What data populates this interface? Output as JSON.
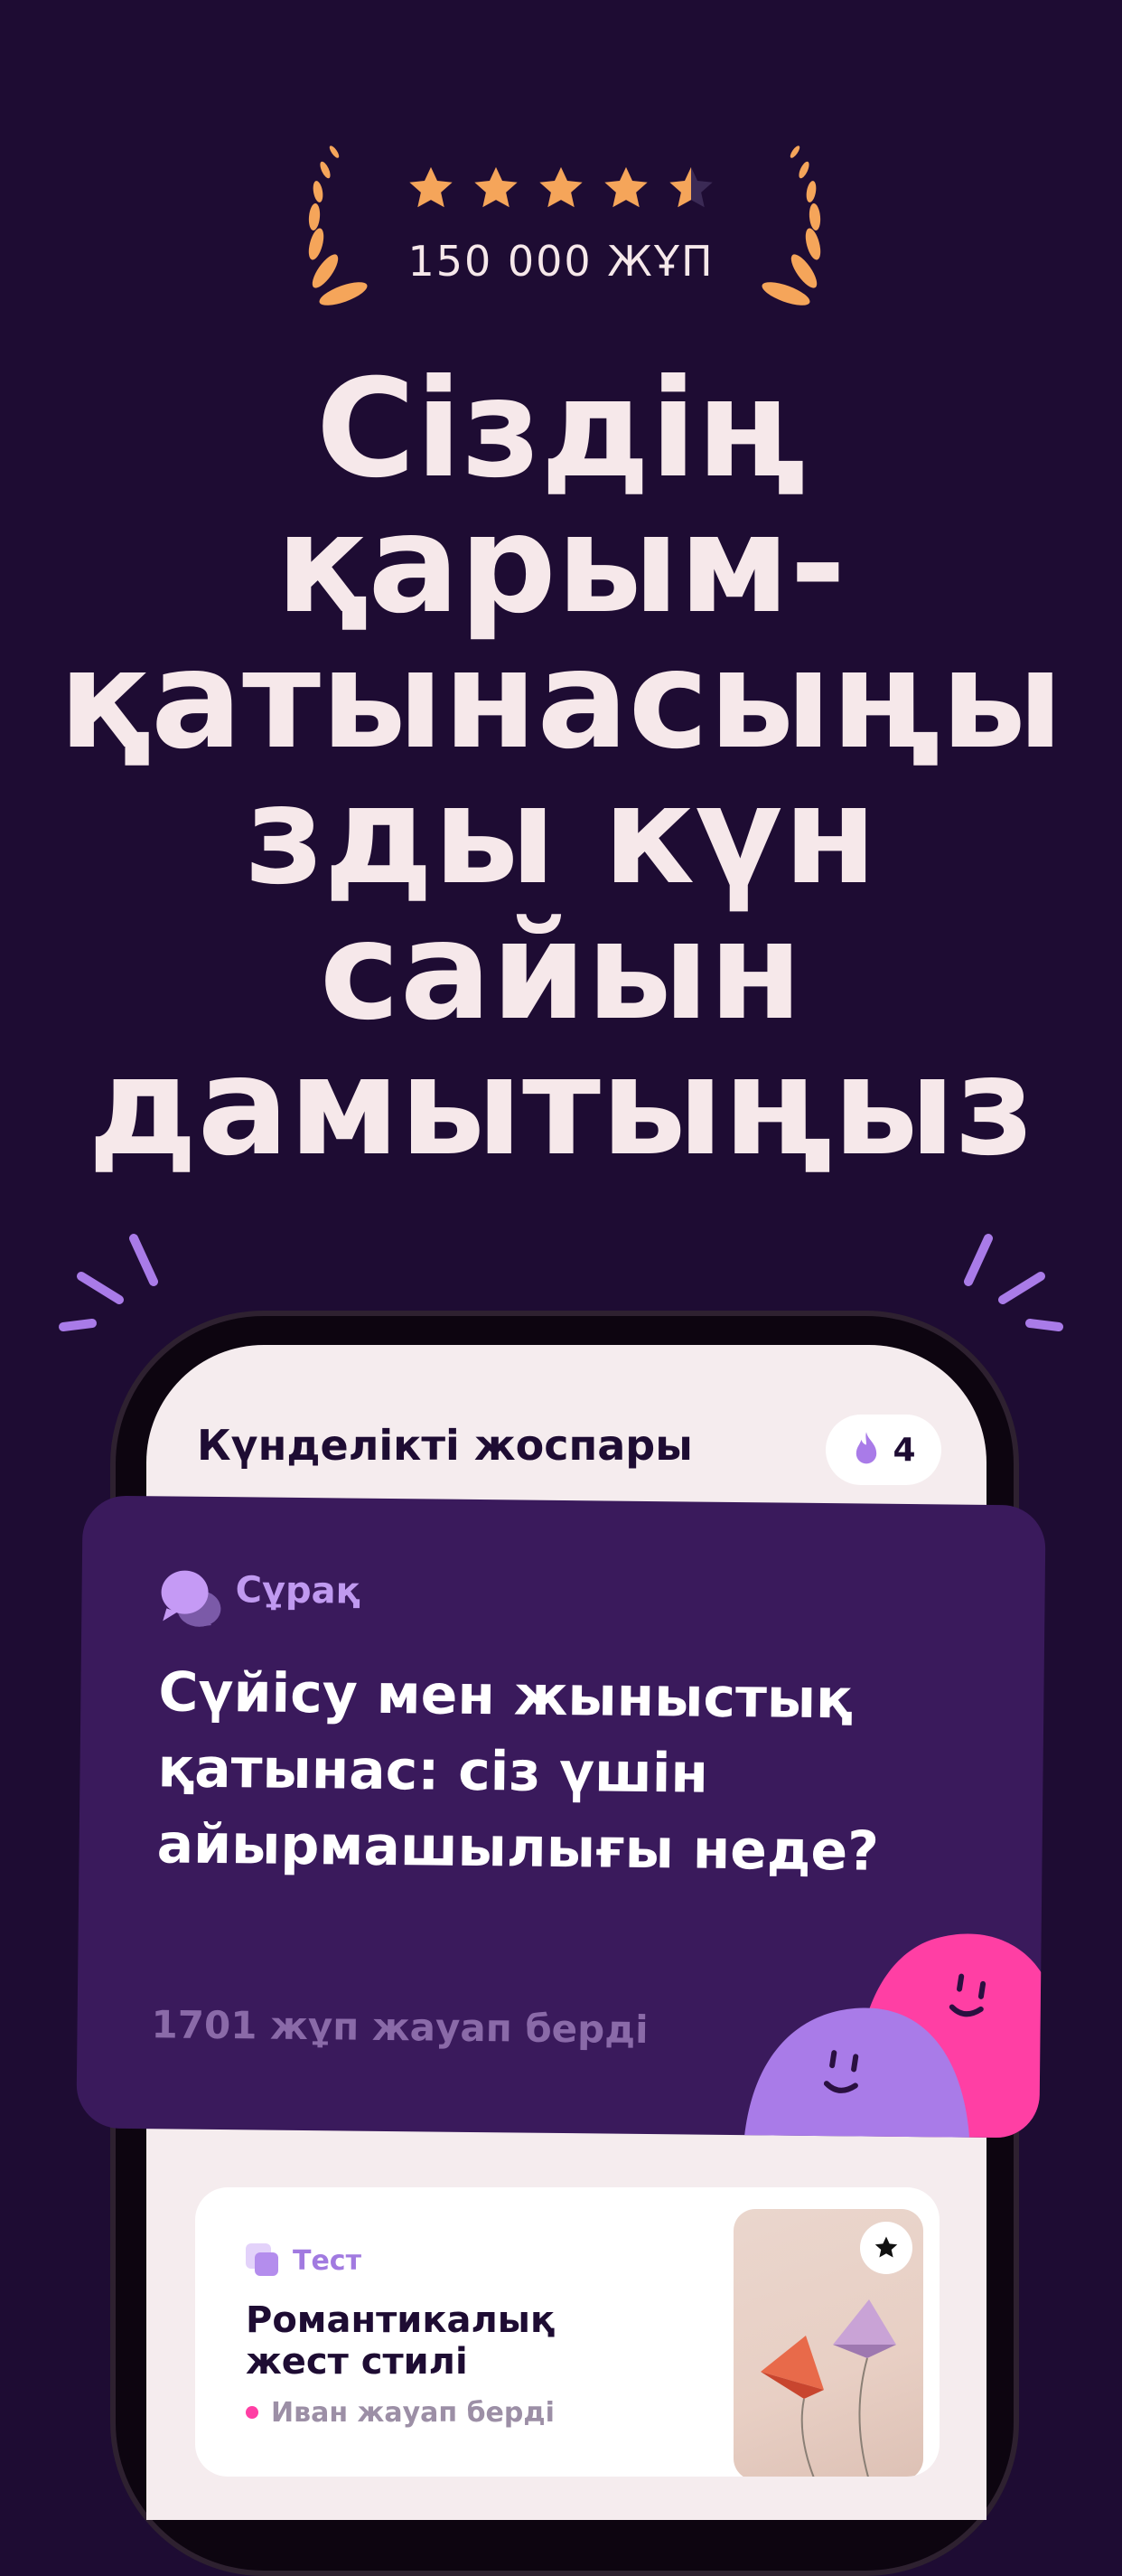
{
  "rating": {
    "stars": 4.5,
    "text": "150 000 ЖҰП",
    "star_color": "#f5a55a",
    "laurel_color": "#f5a55a"
  },
  "headline": {
    "lines": [
      "Сіздің",
      "қарым-",
      "қатынасыңы",
      "зды күн",
      "сайын",
      "дамытыңыз"
    ]
  },
  "app": {
    "daily_plan_title": "Күнделікті жоспары",
    "streak_count": "4",
    "question_card": {
      "label": "Сұрақ",
      "text": "Сүйісу мен жыныстық қатынас: сіз үшін айырмашылығы неде?",
      "answered": "1701 жұп жауап берді"
    },
    "quiz_card": {
      "tag": "Тест",
      "title": "Романтикалық жест стилі",
      "answered": "Иван жауап берді"
    }
  },
  "colors": {
    "background": "#1e0c33",
    "card": "#3a1a5c",
    "accent_purple": "#a97be8",
    "accent_pink": "#ff3fa4"
  }
}
